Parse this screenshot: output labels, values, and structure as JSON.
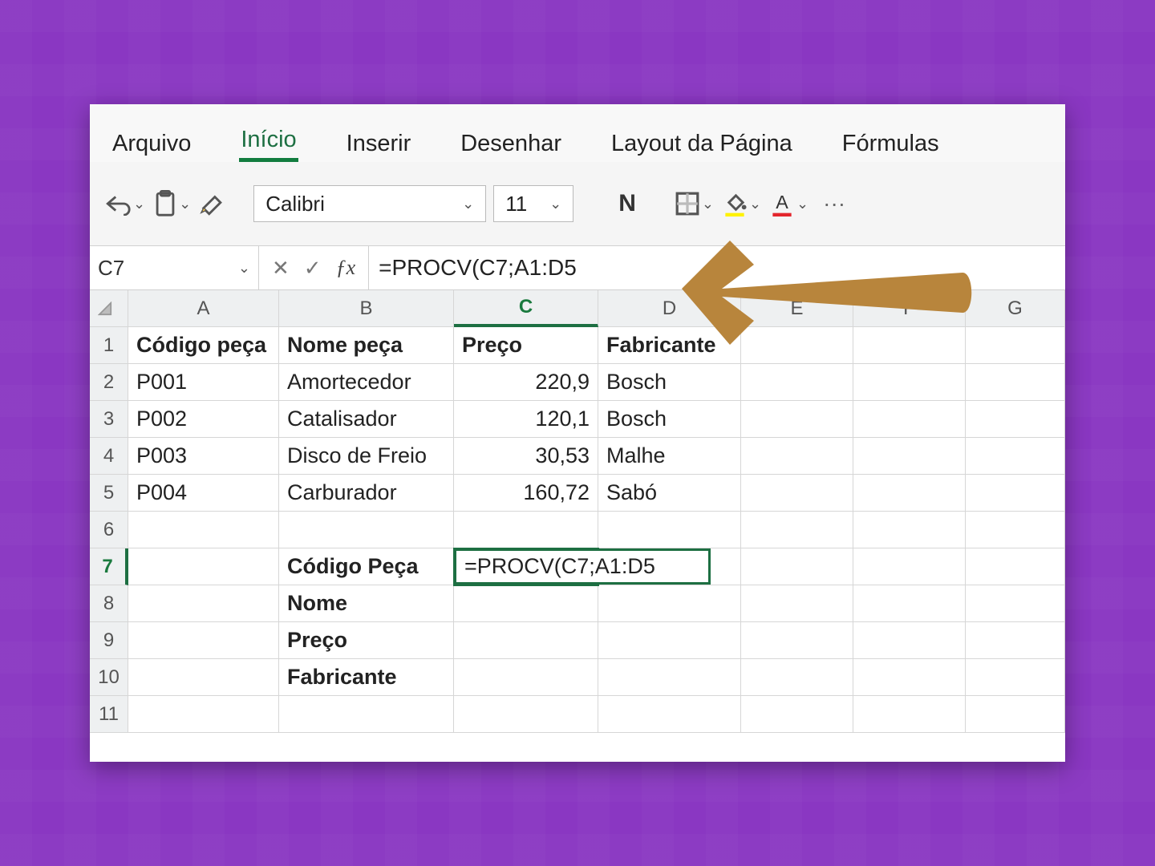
{
  "ribbon_tabs": {
    "arquivo": "Arquivo",
    "inicio": "Início",
    "inserir": "Inserir",
    "desenhar": "Desenhar",
    "layout": "Layout da Página",
    "formulas": "Fórmulas"
  },
  "toolbar": {
    "font_name": "Calibri",
    "font_size": "11",
    "bold_glyph": "N",
    "more": "···"
  },
  "fx": {
    "name_box": "C7",
    "formula": "=PROCV(C7;A1:D5"
  },
  "columns": [
    "A",
    "B",
    "C",
    "D",
    "E",
    "F",
    "G"
  ],
  "rows": [
    "1",
    "2",
    "3",
    "4",
    "5",
    "6",
    "7",
    "8",
    "9",
    "10",
    "11"
  ],
  "headers": {
    "A": "Código peça",
    "B": "Nome peça",
    "C": "Preço",
    "D": "Fabricante"
  },
  "data": [
    {
      "A": "P001",
      "B": "Amortecedor",
      "C": "220,9",
      "D": "Bosch"
    },
    {
      "A": "P002",
      "B": "Catalisador",
      "C": "120,1",
      "D": "Bosch"
    },
    {
      "A": "P003",
      "B": "Disco de Freio",
      "C": "30,53",
      "D": "Malhe"
    },
    {
      "A": "P004",
      "B": "Carburador",
      "C": "160,72",
      "D": "Sabó"
    }
  ],
  "lookup_labels": {
    "b7": "Código Peça",
    "b8": "Nome",
    "b9": "Preço",
    "b10": "Fabricante"
  },
  "active_cell_display": "=PROCV(C7;A1:D5",
  "chart_data": {
    "type": "table",
    "title": "",
    "columns": [
      "Código peça",
      "Nome peça",
      "Preço",
      "Fabricante"
    ],
    "rows": [
      [
        "P001",
        "Amortecedor",
        220.9,
        "Bosch"
      ],
      [
        "P002",
        "Catalisador",
        120.1,
        "Bosch"
      ],
      [
        "P003",
        "Disco de Freio",
        30.53,
        "Malhe"
      ],
      [
        "P004",
        "Carburador",
        160.72,
        "Sabó"
      ]
    ]
  }
}
